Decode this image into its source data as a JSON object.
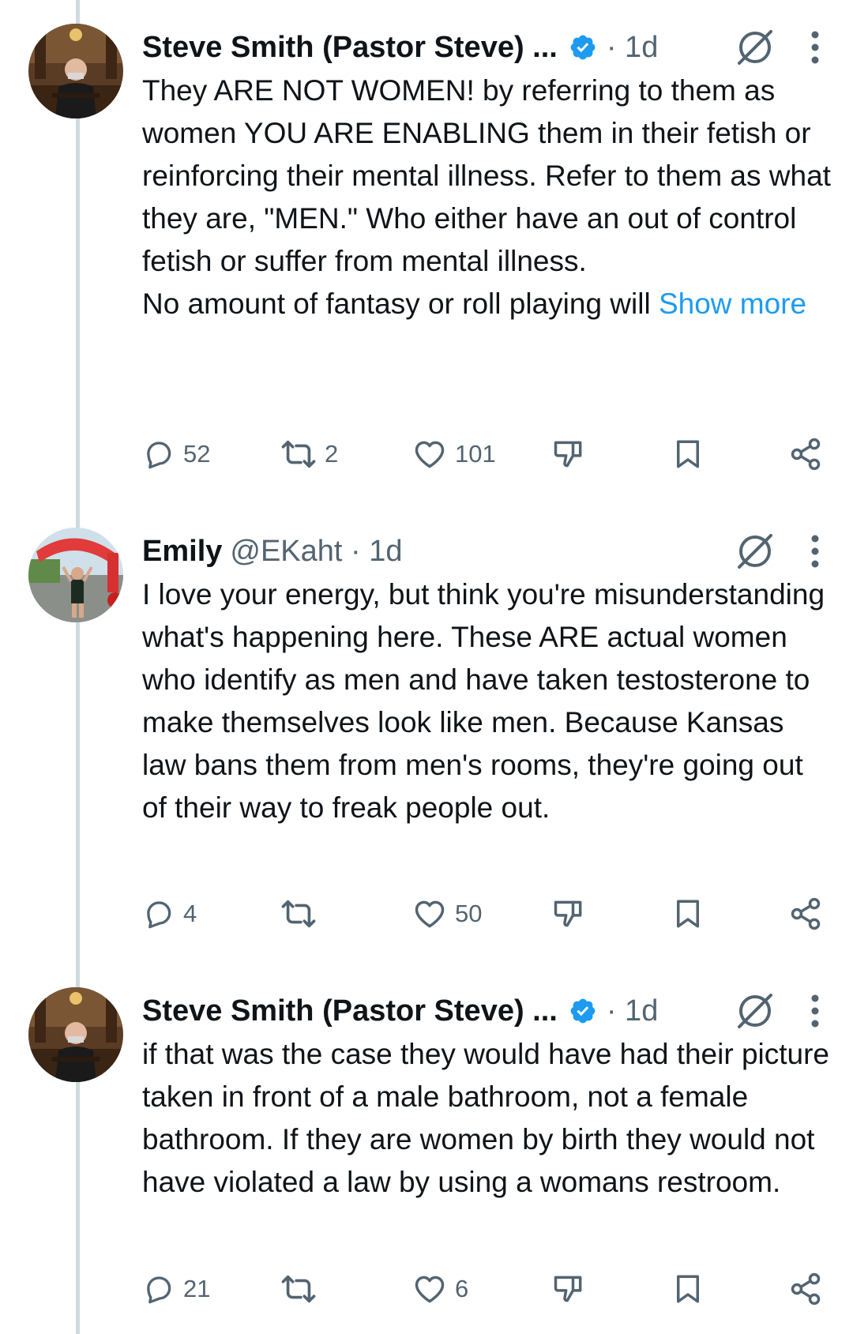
{
  "tweets": [
    {
      "name": "Steve Smith (Pastor Steve) ...",
      "handle": "",
      "verified": true,
      "time": "· 1d",
      "paragraphs": [
        "They ARE NOT WOMEN! by referring to them as women YOU ARE ENABLING them in their fetish or reinforcing their mental illness. Refer to them as what they are, \"MEN.\" Who either have an out of control fetish or suffer from mental illness."
      ],
      "last_line": "No amount of fantasy or roll playing will ",
      "show_more": "Show more",
      "replies": "52",
      "reposts": "2",
      "likes": "101"
    },
    {
      "name": "Emily",
      "handle": "@EKaht · 1d",
      "verified": false,
      "time": "",
      "paragraphs": [
        "I love your energy, but think you're misunderstanding what's happening here. These ARE actual women who identify as men and have taken testosterone to make themselves look like men. Because Kansas law bans them from men's rooms, they're going out of their way to freak people out."
      ],
      "last_line": "",
      "show_more": "",
      "replies": "4",
      "reposts": "",
      "likes": "50"
    },
    {
      "name": "Steve Smith (Pastor Steve) ...",
      "handle": "",
      "verified": true,
      "time": "· 1d",
      "paragraphs": [
        "if that was the case they would have had their picture taken in front of a male bathroom, not a female bathroom. If they are women by birth they would not have violated a law by using a womans restroom."
      ],
      "last_line": "",
      "show_more": "",
      "replies": "21",
      "reposts": "",
      "likes": "6"
    }
  ],
  "colors": {
    "text": "#0f1419",
    "secondary": "#536471",
    "link": "#1d9bf0",
    "verified": "#1d9bf0",
    "thread_line": "#cfd9de"
  },
  "icons": [
    "reply-icon",
    "repost-icon",
    "like-icon",
    "dislike-icon",
    "bookmark-icon",
    "share-icon",
    "grok-icon",
    "more-icon",
    "verified-badge-icon"
  ]
}
